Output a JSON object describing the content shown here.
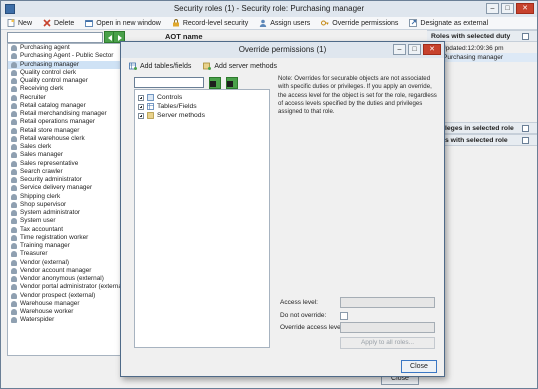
{
  "outer_window": {
    "title": "Security roles (1) - Security role: Purchasing manager",
    "controls": {
      "minimize": "–",
      "maximize": "□",
      "close": "✕"
    }
  },
  "toolbar": {
    "new": "New",
    "delete": "Delete",
    "open_new_window": "Open in new window",
    "record_level_security": "Record-level security",
    "assign_users": "Assign users",
    "override_permissions": "Override permissions",
    "designate_external": "Designate as external"
  },
  "aot_header": "AOT name",
  "roles": [
    "Purchasing agent",
    "Purchasing Agent - Public Sector",
    "Purchasing manager",
    "Quality control clerk",
    "Quality control manager",
    "Receiving clerk",
    "Recruiter",
    "Retail catalog manager",
    "Retail merchandising manager",
    "Retail operations manager",
    "Retail store manager",
    "Retail warehouse clerk",
    "Sales clerk",
    "Sales manager",
    "Sales representative",
    "Search crawler",
    "Security administrator",
    "Service delivery manager",
    "Shipping clerk",
    "Shop supervisor",
    "System administrator",
    "System user",
    "Tax accountant",
    "Time registration worker",
    "Training manager",
    "Treasurer",
    "Vendor (external)",
    "Vendor account manager",
    "Vendor anonymous (external)",
    "Vendor portal administrator (external)",
    "Vendor prospect (external)",
    "Warehouse manager",
    "Warehouse worker",
    "Waterspider"
  ],
  "selected_role_index": 2,
  "right_pane": {
    "roles_with_duty": "Roles with selected duty",
    "updated": "Updated:12:09:36 pm",
    "purchasing_manager": "Purchasing manager",
    "privileges_header": "leges in selected role",
    "duties_header": "s with selected role"
  },
  "bottom_close": "Close",
  "dialog": {
    "title": "Override permissions (1)",
    "add_tables": "Add tables/fields",
    "add_server_methods": "Add server methods",
    "tree": [
      "Controls",
      "Tables/Fields",
      "Server methods"
    ],
    "note": "Note: Overrides for securable objects are not associated with specific duties or privileges. If you apply an override, the access level for the object is set for the role, regardless of access levels specified by the duties and privileges assigned to that role.",
    "access_level_label": "Access level:",
    "do_not_override_label": "Do not override:",
    "override_access_label": "Override access level:",
    "apply_all_roles": "Apply to all roles...",
    "close": "Close",
    "controls": {
      "minimize": "–",
      "maximize": "□",
      "close": "✕"
    }
  }
}
